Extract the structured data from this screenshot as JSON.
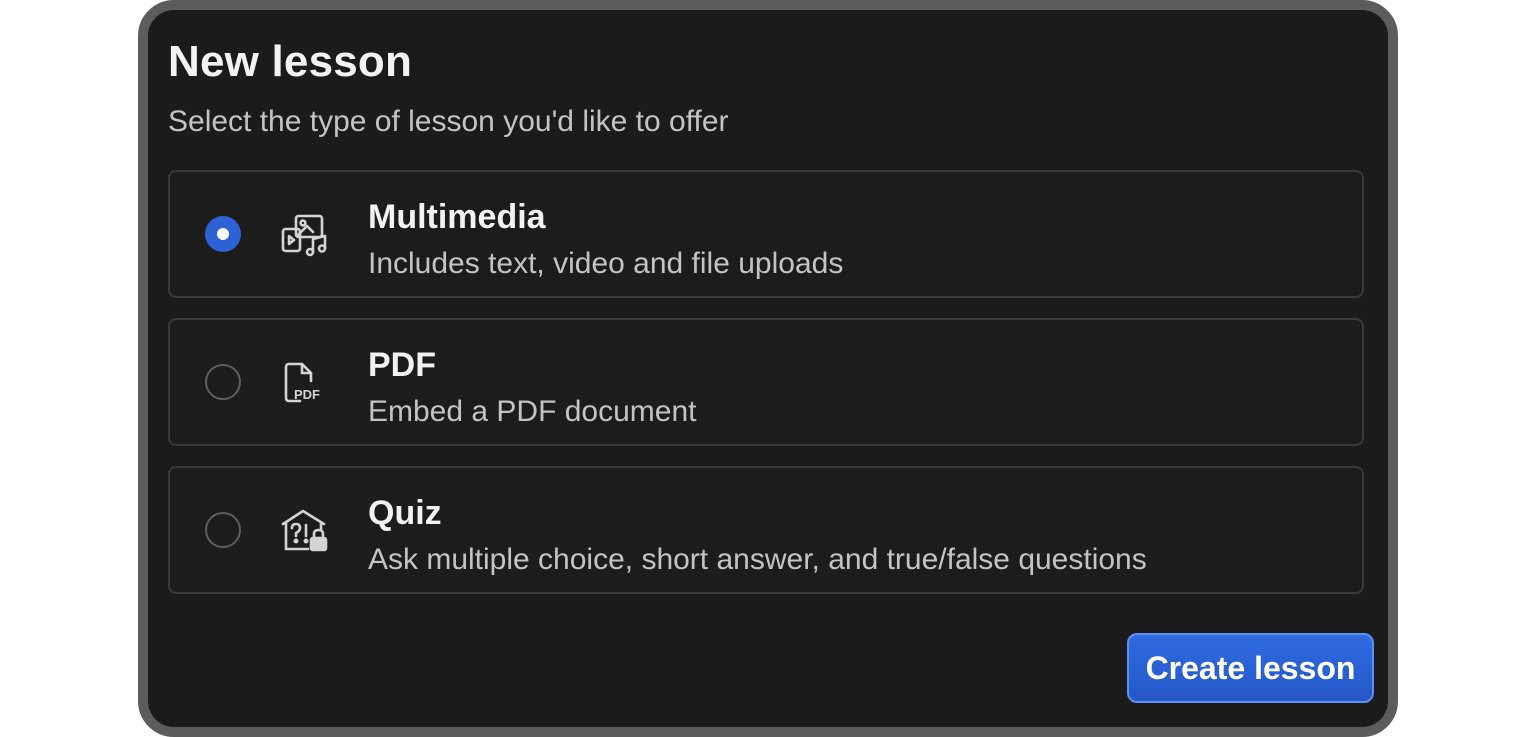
{
  "dialog": {
    "title": "New lesson",
    "subtitle": "Select the type of lesson you'd like to offer"
  },
  "options": [
    {
      "label": "Multimedia",
      "description": "Includes text, video and file uploads",
      "icon": "multimedia-icon",
      "selected": true
    },
    {
      "label": "PDF",
      "description": "Embed a PDF document",
      "icon": "pdf-document-icon",
      "icon_text": "PDF",
      "selected": false
    },
    {
      "label": "Quiz",
      "description": "Ask multiple choice, short answer, and true/false questions",
      "icon": "quiz-icon",
      "selected": false
    }
  ],
  "actions": {
    "create_label": "Create lesson"
  },
  "colors": {
    "accent": "#2b63d6",
    "background": "#1b1b1b",
    "frame": "#5c5c5c",
    "text_primary": "#f2f2f2",
    "text_secondary": "#c4c4c4"
  }
}
